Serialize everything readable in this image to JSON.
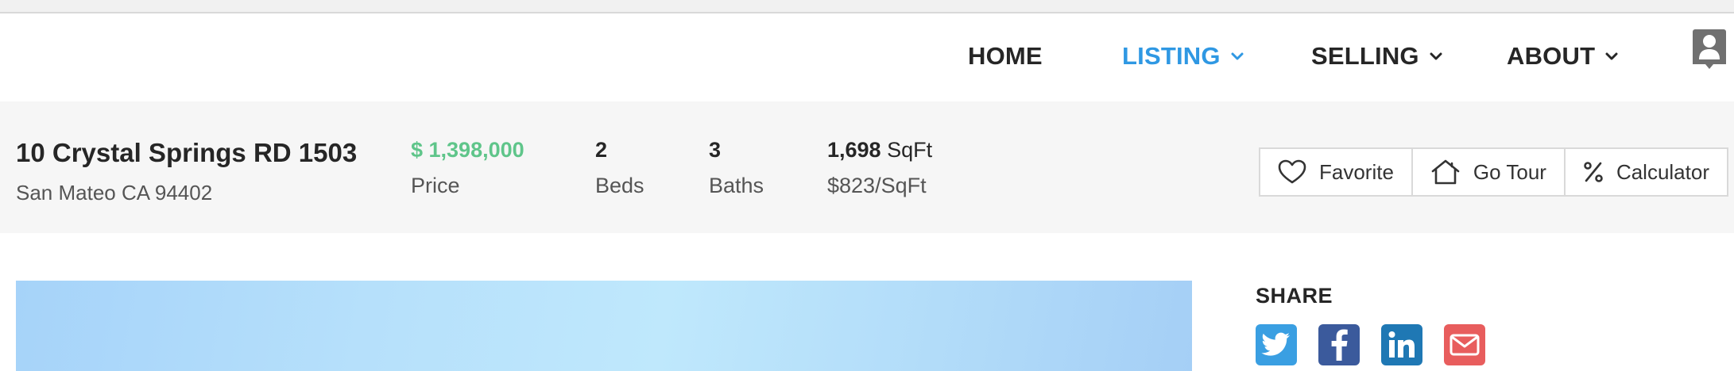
{
  "nav": {
    "items": [
      {
        "label": "HOME",
        "has_dropdown": false,
        "active": false
      },
      {
        "label": "LISTING",
        "has_dropdown": true,
        "active": true
      },
      {
        "label": "SELLING",
        "has_dropdown": true,
        "active": false
      },
      {
        "label": "ABOUT",
        "has_dropdown": true,
        "active": false
      }
    ],
    "user_icon": "user-account-icon",
    "accent_color": "#2f98e3"
  },
  "listing": {
    "street": "10 Crystal Springs RD 1503",
    "city_state_zip": "San Mateo CA 94402",
    "price": "$ 1,398,000",
    "price_label": "Price",
    "beds": "2",
    "beds_label": "Beds",
    "baths": "3",
    "baths_label": "Baths",
    "sqft": "1,698",
    "sqft_unit": "SqFt",
    "price_per_sqft": "$823/SqFt",
    "price_color": "#5fc58a"
  },
  "actions": [
    {
      "label": "Favorite",
      "icon": "heart-icon"
    },
    {
      "label": "Go Tour",
      "icon": "house-icon"
    },
    {
      "label": "Calculator",
      "icon": "percent-icon"
    }
  ],
  "share": {
    "title": "SHARE",
    "networks": [
      {
        "name": "twitter",
        "icon": "twitter-icon",
        "color": "#3a9fe2"
      },
      {
        "name": "facebook",
        "icon": "facebook-icon",
        "color": "#3b5a9c"
      },
      {
        "name": "linkedin",
        "icon": "linkedin-icon",
        "color": "#1f78b4"
      },
      {
        "name": "email",
        "icon": "email-icon",
        "color": "#e85d5d"
      }
    ]
  }
}
